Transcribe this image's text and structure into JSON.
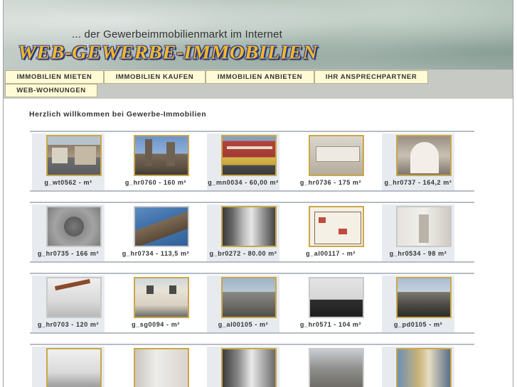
{
  "header": {
    "tagline": "... der Gewerbeimmobilienmarkt im Internet",
    "logo_text": "WEB-GEWERBE-IMMOBILIEN"
  },
  "nav": {
    "tabs": [
      {
        "label": "IMMOBILIEN MIETEN"
      },
      {
        "label": "IMMOBILIEN KAUFEN"
      },
      {
        "label": "IMMOBILIEN ANBIETEN"
      },
      {
        "label": "IHR ANSPRECHPARTNER"
      },
      {
        "label": "WEB-WOHNUNGEN"
      }
    ]
  },
  "content": {
    "welcome": "Herzlich willkommen bei Gewerbe-Immobilien",
    "rows": [
      [
        {
          "caption": "g_wt0562 - m²"
        },
        {
          "caption": "g_hr0760 - 160 m²"
        },
        {
          "caption": "g_mn0034 - 60,00 m²"
        },
        {
          "caption": "g_hr0736 - 175 m²"
        },
        {
          "caption": "g_hr0737 - 164,2 m²"
        }
      ],
      [
        {
          "caption": "g_hr0735 - 166 m²"
        },
        {
          "caption": "g_hr0734 - 113,5 m²"
        },
        {
          "caption": "g_br0272 - 80.00 m²"
        },
        {
          "caption": "g_al00117 - m²"
        },
        {
          "caption": "g_hr0534 - 98 m²"
        }
      ],
      [
        {
          "caption": "g_hr0703 - 120 m²"
        },
        {
          "caption": "g_sg0094 - m²"
        },
        {
          "caption": "g_al00105 - m²"
        },
        {
          "caption": "g_hr0571 - 104 m²"
        },
        {
          "caption": "g_pd0105 - m²"
        }
      ],
      [
        {
          "caption": ""
        },
        {
          "caption": ""
        },
        {
          "caption": ""
        },
        {
          "caption": ""
        },
        {
          "caption": ""
        }
      ]
    ]
  },
  "colors": {
    "tab_bg": "#fffbd6",
    "navbar_bg": "#c7c9c5",
    "thumb_border": "#c9a84a",
    "logo_fill": "#f6b82a",
    "logo_outline": "#2a3a8a"
  }
}
